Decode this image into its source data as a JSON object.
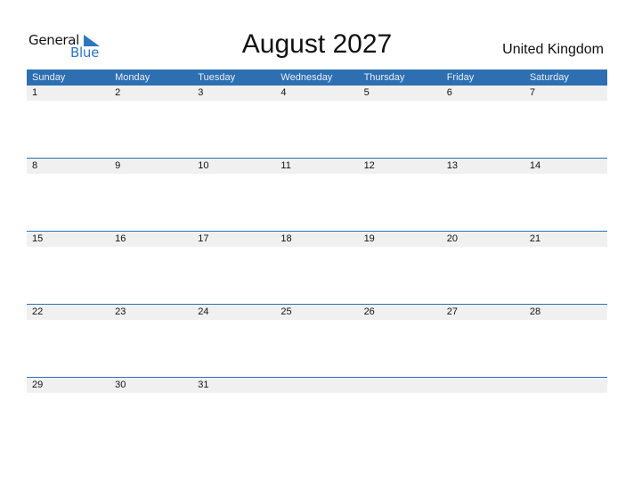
{
  "logo": {
    "general": "General",
    "blue": "Blue"
  },
  "title": "August 2027",
  "country": "United Kingdom",
  "days": [
    "Sunday",
    "Monday",
    "Tuesday",
    "Wednesday",
    "Thursday",
    "Friday",
    "Saturday"
  ],
  "weeks": [
    [
      "1",
      "2",
      "3",
      "4",
      "5",
      "6",
      "7"
    ],
    [
      "8",
      "9",
      "10",
      "11",
      "12",
      "13",
      "14"
    ],
    [
      "15",
      "16",
      "17",
      "18",
      "19",
      "20",
      "21"
    ],
    [
      "22",
      "23",
      "24",
      "25",
      "26",
      "27",
      "28"
    ],
    [
      "29",
      "30",
      "31",
      "",
      "",
      "",
      ""
    ]
  ]
}
